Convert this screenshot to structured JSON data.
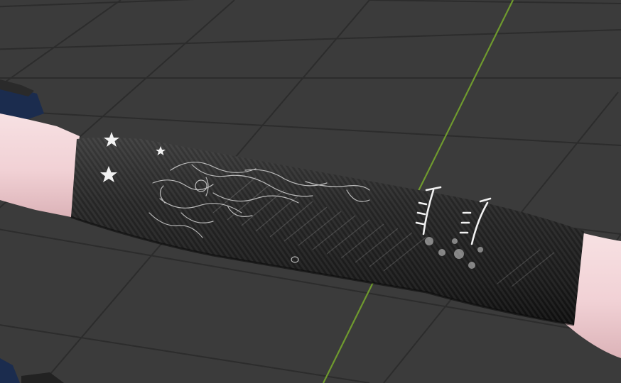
{
  "viewport": {
    "background": "#3b3b3b",
    "grid_color": "#2b2b2b",
    "axis_color": "#6f9a2e"
  },
  "model": {
    "skin_color": "#f3d6d9",
    "sleeve_color": "#1c1c1c",
    "clothing_color": "#1b2c4e",
    "decal_color": "#f2f2f2"
  },
  "icons": {
    "star": "star-icon"
  }
}
